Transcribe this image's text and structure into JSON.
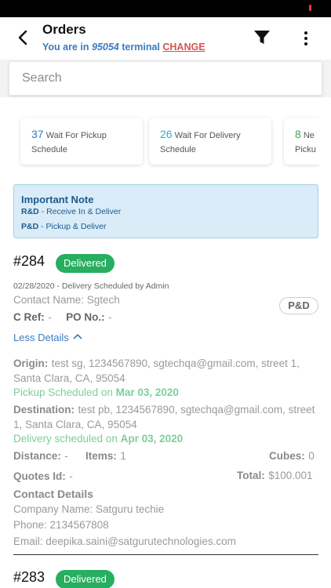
{
  "header": {
    "title": "Orders",
    "subtitle_prefix": "You are in",
    "terminal_code": "95054",
    "subtitle_suffix": "terminal",
    "change_label": "CHANGE"
  },
  "search": {
    "placeholder": "Search"
  },
  "summary_cards": [
    {
      "count": "37",
      "label_line1": "Wait For Pickup",
      "label_line2": "Schedule",
      "color": "#3b7bbf"
    },
    {
      "count": "26",
      "label_line1": "Wait For Delivery",
      "label_line2": "Schedule",
      "color": "#26b4c9"
    },
    {
      "count": "8",
      "label_line1": "Ne",
      "label_line2": "Picku",
      "color": "#2bb04c"
    }
  ],
  "note": {
    "title": "Important Note",
    "lines": [
      {
        "code": "R&D",
        "text": " - Receive In & Deliver"
      },
      {
        "code": "P&D",
        "text": " - Pickup & Deliver"
      }
    ]
  },
  "orders": [
    {
      "id": "#284",
      "status": "Delivered",
      "scheduled_line": "02/28/2020 - Delivery Scheduled by Admin",
      "contact_name": "Contact Name: Sgtech",
      "c_ref_label": "C Ref:",
      "c_ref_value": "-",
      "po_label": "PO No.:",
      "po_value": "-",
      "type_badge": "P&D",
      "less_details_label": "Less Details",
      "origin_label": "Origin:",
      "origin_value": "test sg, 1234567890, sgtechqa@gmail.com, street 1, Santa Clara, CA, 95054",
      "pickup_prefix": "Pickup Scheduled on",
      "pickup_date": "Mar 03, 2020",
      "destination_label": "Destination:",
      "destination_value": "test pb, 1234567890, sgtechqa@gmail.com, street 1, Santa Clara, CA, 95054",
      "delivery_prefix": "Delivery scheduled on",
      "delivery_date": "Apr 03, 2020",
      "distance_label": "Distance:",
      "distance_value": "-",
      "items_label": "Items:",
      "items_value": "1",
      "cubes_label": "Cubes:",
      "cubes_value": "0",
      "quotes_label": "Quotes Id:",
      "quotes_value": "-",
      "total_label": "Total:",
      "total_value": "$100.001",
      "contact_details_label": "Contact Details",
      "company_line": "Company Name: Satguru techie",
      "phone_line": "Phone: 2134567808",
      "email_line": "Email: deepika.saini@satgurutechnologies.com"
    },
    {
      "id": "#283",
      "status": "Delivered"
    }
  ]
}
